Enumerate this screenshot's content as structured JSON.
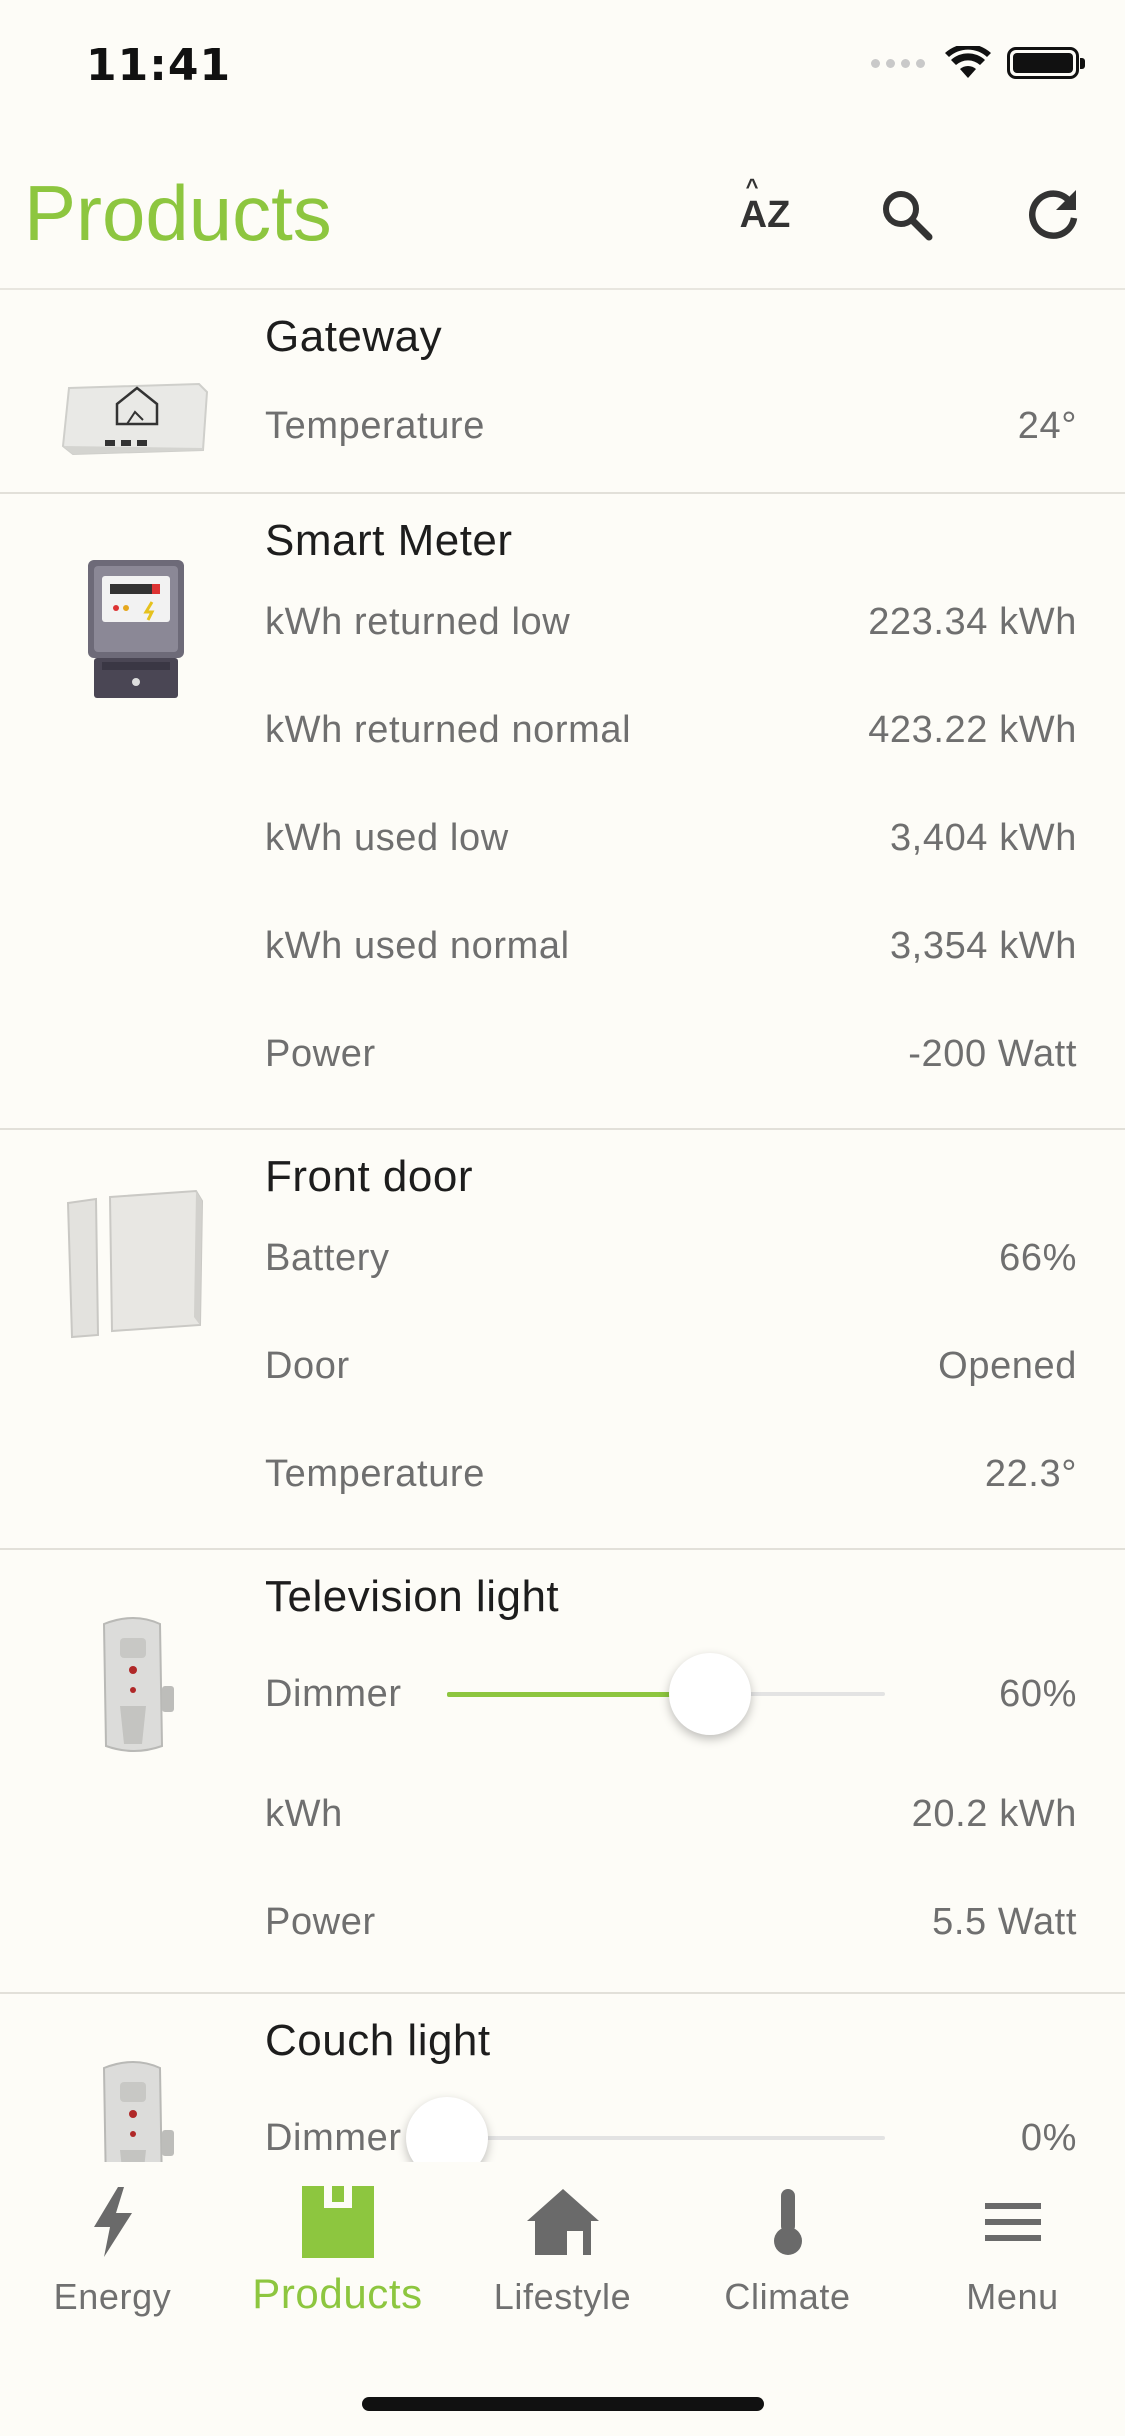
{
  "status_bar": {
    "time": "11:41"
  },
  "header": {
    "title": "Products",
    "sort_label": "AZ"
  },
  "products": [
    {
      "name": "Gateway",
      "image": "gateway-device",
      "properties": [
        {
          "label": "Temperature",
          "value": "24°"
        }
      ]
    },
    {
      "name": "Smart Meter",
      "image": "smart-meter-device",
      "properties": [
        {
          "label": "kWh returned low",
          "value": "223.34 kWh"
        },
        {
          "label": "kWh returned normal",
          "value": "423.22 kWh"
        },
        {
          "label": "kWh used low",
          "value": "3,404 kWh"
        },
        {
          "label": "kWh used normal",
          "value": "3,354 kWh"
        },
        {
          "label": "Power",
          "value": "-200 Watt"
        }
      ]
    },
    {
      "name": "Front door",
      "image": "door-sensor-device",
      "properties": [
        {
          "label": "Battery",
          "value": "66%"
        },
        {
          "label": "Door",
          "value": "Opened"
        },
        {
          "label": "Temperature",
          "value": "22.3°"
        }
      ]
    },
    {
      "name": "Television light",
      "image": "smart-plug-device",
      "dimmer": {
        "label": "Dimmer",
        "value": "60%",
        "level": 0.6
      },
      "properties": [
        {
          "label": "kWh",
          "value": "20.2 kWh"
        },
        {
          "label": "Power",
          "value": "5.5 Watt"
        }
      ]
    },
    {
      "name": "Couch light",
      "image": "smart-plug-device",
      "dimmer": {
        "label": "Dimmer",
        "value": "0%",
        "level": 0
      }
    }
  ],
  "tabs": [
    {
      "label": "Energy",
      "icon": "lightning-icon"
    },
    {
      "label": "Products",
      "icon": "products-icon",
      "active": true
    },
    {
      "label": "Lifestyle",
      "icon": "house-icon"
    },
    {
      "label": "Climate",
      "icon": "thermometer-icon"
    },
    {
      "label": "Menu",
      "icon": "hamburger-icon"
    }
  ],
  "colors": {
    "accent": "#8dc63f",
    "background": "#fdfcf7",
    "text_secondary": "#6f6f6f"
  }
}
